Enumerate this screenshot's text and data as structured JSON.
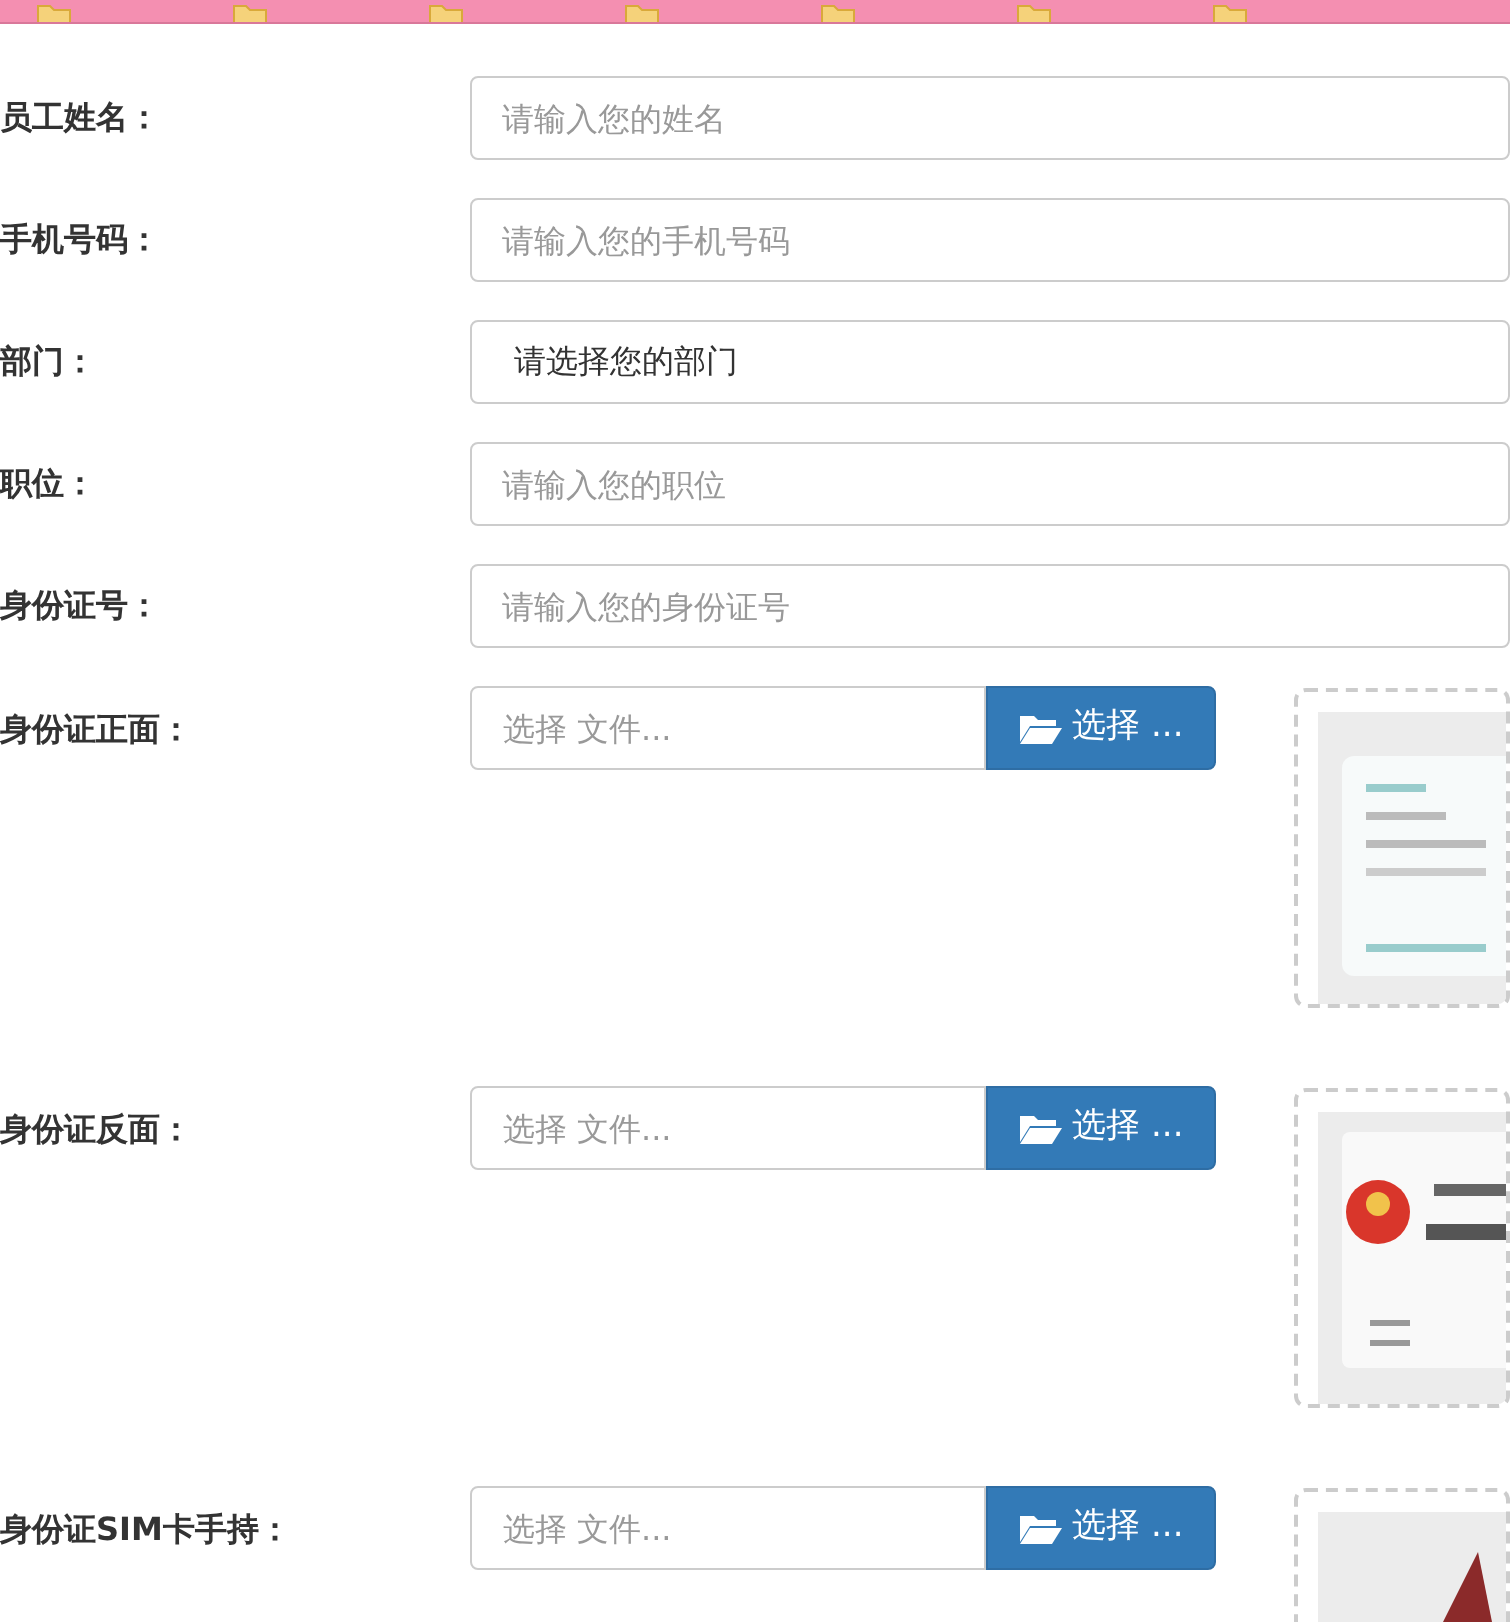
{
  "fields": [
    {
      "label": "员工姓名：",
      "kind": "text",
      "placeholder": "请输入您的姓名"
    },
    {
      "label": "手机号码：",
      "kind": "text",
      "placeholder": "请输入您的手机号码"
    },
    {
      "label": "部门：",
      "kind": "select",
      "value": "请选择您的部门"
    },
    {
      "label": "职位：",
      "kind": "text",
      "placeholder": "请输入您的职位"
    },
    {
      "label": "身份证号：",
      "kind": "text",
      "placeholder": "请输入您的身份证号"
    }
  ],
  "uploads": [
    {
      "label": "身份证正面：",
      "placeholder": "选择 文件...",
      "button": "选择 ..."
    },
    {
      "label": "身份证反面：",
      "placeholder": "选择 文件...",
      "button": "选择 ..."
    },
    {
      "label": "身份证SIM卡手持：",
      "placeholder": "选择 文件...",
      "button": "选择 ..."
    }
  ]
}
